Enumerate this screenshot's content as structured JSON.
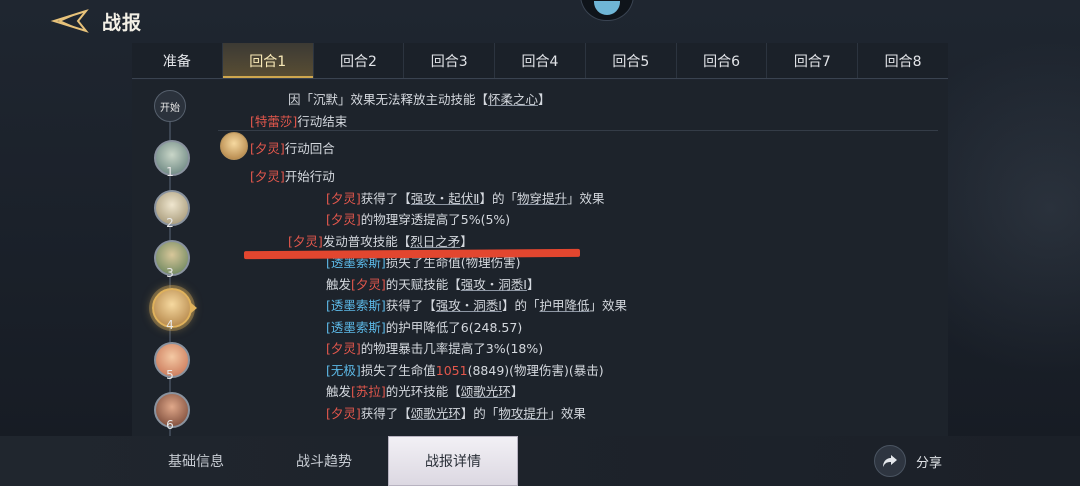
{
  "header": {
    "title": "战报"
  },
  "round_tabs": [
    "准备",
    "回合1",
    "回合2",
    "回合3",
    "回合4",
    "回合5",
    "回合6",
    "回合7",
    "回合8"
  ],
  "active_round_tab": "回合1",
  "timeline": {
    "start_label": "开始",
    "nodes": [
      "1",
      "2",
      "3",
      "4",
      "5",
      "6"
    ],
    "active_node": "4"
  },
  "log": {
    "l1": {
      "a": "因「沉默」效果无法释放主动技能【",
      "b": "怀柔之心",
      "c": "】"
    },
    "l2": {
      "a": "[特蕾莎]",
      "b": "行动结束"
    },
    "l3": {
      "a": "[夕灵]",
      "b": "行动回合"
    },
    "l4": {
      "a": "[夕灵]",
      "b": "开始行动"
    },
    "l5": {
      "a": "[夕灵]",
      "b": "获得了【",
      "c": "强攻・起伏Ⅱ",
      "d": "】的「",
      "e": "物穿提升",
      "f": "」效果"
    },
    "l6": {
      "a": "[夕灵]",
      "b": "的物理穿透提高了5%(5%)"
    },
    "l7": {
      "a": "[夕灵]",
      "b": "发动普攻技能【",
      "c": "烈日之矛",
      "d": "】"
    },
    "l8": {
      "a": "[透墨索斯]",
      "b": "损失了生命值",
      "c": "(物理伤害)"
    },
    "l9": {
      "a": "触发",
      "b": "[夕灵]",
      "c": "的天赋技能【",
      "d": "强攻・洞悉Ⅰ",
      "e": "】"
    },
    "l10": {
      "a": "[透墨索斯]",
      "b": "获得了【",
      "c": "强攻・洞悉Ⅰ",
      "d": "】的「",
      "e": "护甲降低",
      "f": "」效果"
    },
    "l11": {
      "a": "[透墨索斯]",
      "b": "的护甲降低了6(248.57)"
    },
    "l12": {
      "a": "[夕灵]",
      "b": "的物理暴击几率提高了3%(18%)"
    },
    "l13": {
      "a": "[无极]",
      "b": "损失了生命值",
      "c": "1051",
      "d": "(8849)(物理伤害)(暴击)"
    },
    "l14": {
      "a": "触发",
      "b": "[苏拉]",
      "c": "的光环技能【",
      "d": "颂歌光环",
      "e": "】"
    },
    "l15": {
      "a": "[夕灵]",
      "b": "获得了【",
      "c": "颂歌光环",
      "d": "】的「",
      "e": "物攻提升",
      "f": "」效果"
    }
  },
  "bottom_tabs": [
    "基础信息",
    "战斗趋势",
    "战报详情"
  ],
  "active_bottom_tab": "战报详情",
  "share": {
    "label": "分享"
  },
  "colors": {
    "accent_gold": "#cfa74e",
    "red_name": "#e2574c",
    "blue_name": "#5cb8e6",
    "panel": "#1d232b"
  }
}
